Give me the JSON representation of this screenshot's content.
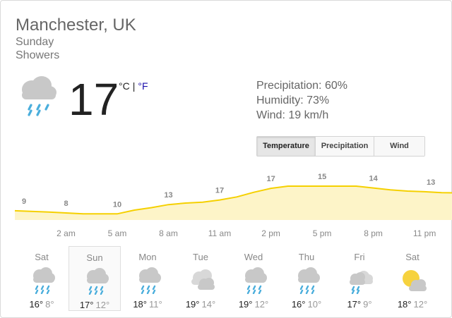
{
  "location": "Manchester, UK",
  "day": "Sunday",
  "condition": "Showers",
  "current": {
    "temp": "17",
    "unit_c": "°C",
    "unit_sep": "|",
    "unit_f": "°F",
    "icon": "showers-icon"
  },
  "stats": {
    "precipitation": "Precipitation: 60%",
    "humidity": "Humidity: 73%",
    "wind": "Wind: 19 km/h"
  },
  "tabs": [
    {
      "label": "Temperature",
      "active": true
    },
    {
      "label": "Precipitation",
      "active": false
    },
    {
      "label": "Wind",
      "active": false
    }
  ],
  "colors": {
    "chart_fill": "#fdf4c8",
    "chart_line": "#f5d000",
    "chart_label": "#888888",
    "rain": "#4aaedc",
    "cloud": "#c8c8c8",
    "sun": "#f6d23e"
  },
  "chart_data": {
    "type": "area",
    "x": [
      "2 am",
      "5 am",
      "8 am",
      "11 am",
      "2 pm",
      "5 pm",
      "8 pm",
      "11 pm"
    ],
    "labels": [
      "9",
      "8",
      "10",
      "13",
      "17",
      "17",
      "15",
      "14",
      "13"
    ],
    "label_hours": [
      0,
      3,
      6,
      9,
      12,
      15,
      18,
      21,
      24
    ],
    "hourly": [
      [
        0,
        9.0
      ],
      [
        2,
        8.6
      ],
      [
        3,
        8.3
      ],
      [
        4,
        8.0
      ],
      [
        5,
        8.0
      ],
      [
        6,
        8.0
      ],
      [
        7,
        9.2
      ],
      [
        8,
        10.0
      ],
      [
        9,
        11.0
      ],
      [
        10,
        11.5
      ],
      [
        11,
        11.8
      ],
      [
        12,
        12.5
      ],
      [
        13,
        13.5
      ],
      [
        14,
        15.0
      ],
      [
        15,
        16.3
      ],
      [
        16,
        17.0
      ],
      [
        17,
        17.0
      ],
      [
        18,
        17.0
      ],
      [
        19,
        17.0
      ],
      [
        20,
        17.0
      ],
      [
        21,
        16.4
      ],
      [
        22,
        15.8
      ],
      [
        23,
        15.4
      ],
      [
        24,
        15.2
      ],
      [
        25,
        14.9
      ],
      [
        26,
        14.8
      ],
      [
        27,
        14.7
      ],
      [
        28,
        14.3
      ],
      [
        29,
        14.0
      ],
      [
        30,
        14.0
      ],
      [
        31,
        13.7
      ],
      [
        32,
        13.5
      ]
    ],
    "ylim": [
      0,
      20
    ],
    "grid": false
  },
  "forecast": [
    {
      "day": "Sat",
      "hi": "16°",
      "lo": "8°",
      "icon": "showers-icon",
      "selected": false
    },
    {
      "day": "Sun",
      "hi": "17°",
      "lo": "12°",
      "icon": "showers-icon",
      "selected": true
    },
    {
      "day": "Mon",
      "hi": "18°",
      "lo": "11°",
      "icon": "showers-icon",
      "selected": false
    },
    {
      "day": "Tue",
      "hi": "19°",
      "lo": "14°",
      "icon": "cloudy-icon",
      "selected": false
    },
    {
      "day": "Wed",
      "hi": "19°",
      "lo": "12°",
      "icon": "showers-icon",
      "selected": false
    },
    {
      "day": "Thu",
      "hi": "16°",
      "lo": "10°",
      "icon": "showers-icon",
      "selected": false
    },
    {
      "day": "Fri",
      "hi": "17°",
      "lo": "9°",
      "icon": "rain-and-clouds-icon",
      "selected": false
    },
    {
      "day": "Sat",
      "hi": "18°",
      "lo": "12°",
      "icon": "partly-cloudy-icon",
      "selected": false
    }
  ]
}
